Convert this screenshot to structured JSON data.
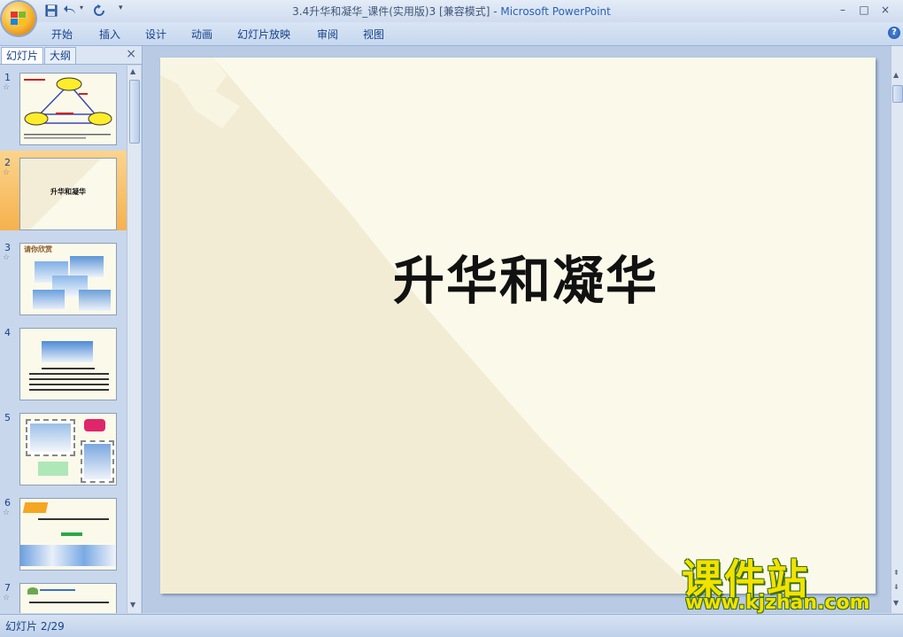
{
  "window": {
    "title": "3.4升华和凝华_课件(实用版)3 [兼容模式]",
    "title_sep": " - ",
    "app_name": "Microsoft PowerPoint",
    "controls": {
      "minimize": "–",
      "maximize": "□",
      "close": "×"
    }
  },
  "quick_access": [
    "save-icon",
    "undo-icon",
    "redo-icon",
    "customize-icon"
  ],
  "ribbon": {
    "tabs": [
      "开始",
      "插入",
      "设计",
      "动画",
      "幻灯片放映",
      "审阅",
      "视图"
    ],
    "help": "?"
  },
  "panel": {
    "tabs": [
      "幻灯片",
      "大纲"
    ],
    "close": "×",
    "slides": [
      {
        "num": "1"
      },
      {
        "num": "2",
        "title": "升华和凝华",
        "selected": true
      },
      {
        "num": "3",
        "title": "请你欣赏"
      },
      {
        "num": "4"
      },
      {
        "num": "5"
      },
      {
        "num": "6"
      },
      {
        "num": "7"
      }
    ]
  },
  "slide": {
    "title": "升华和凝华"
  },
  "status": {
    "slide_count": "幻灯片 2/29"
  },
  "watermark": {
    "title": "课件站",
    "url": "www.kjzhan.com"
  },
  "colors": {
    "accent": "#15428b",
    "selected_thumb": "#f6b14d",
    "slide_bg": "#fbfaea"
  }
}
